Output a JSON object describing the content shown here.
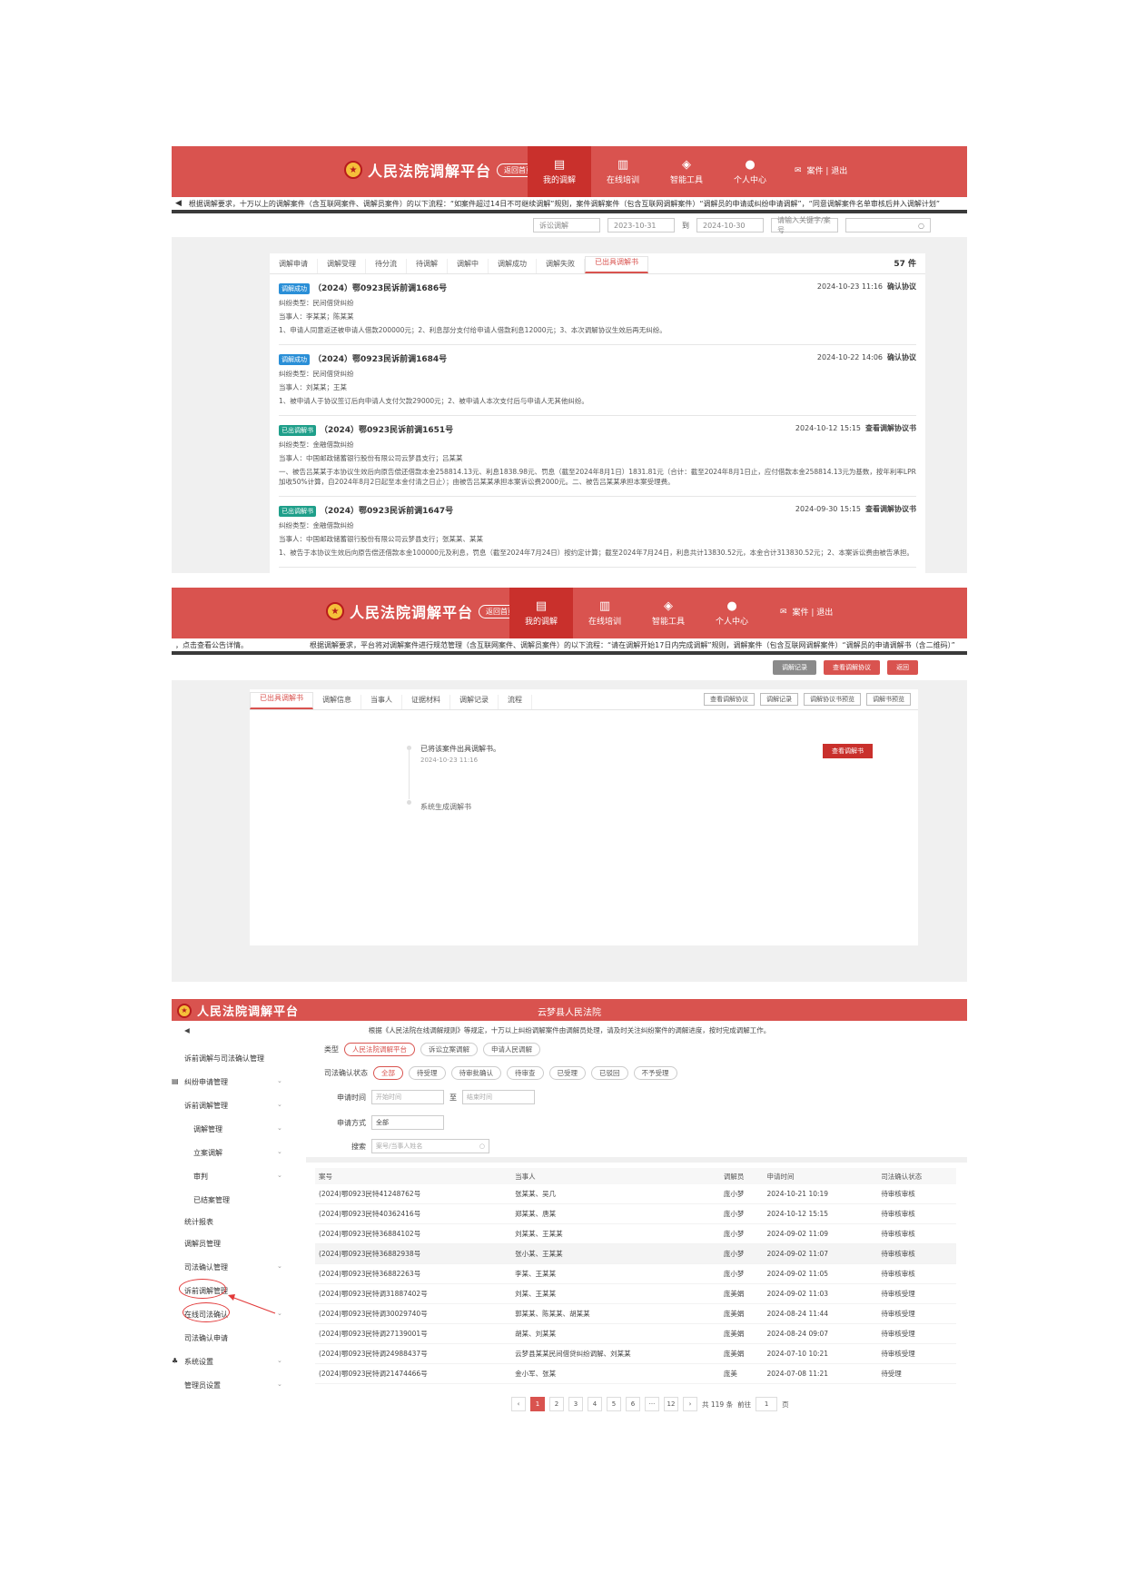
{
  "platform": {
    "name": "人民法院调解平台"
  },
  "shot1": {
    "pill": "返回首页",
    "nav": [
      {
        "icon": "▤",
        "label": "我的调解"
      },
      {
        "icon": "▥",
        "label": "在线培训"
      },
      {
        "icon": "◈",
        "label": "智能工具"
      },
      {
        "icon": "●",
        "label": "个人中心"
      }
    ],
    "user_links": "案件 | 退出",
    "ticker": "根据调解要求，十万以上的调解案件（含互联网案件、调解员案件）的以下流程：“如案件超过14日不可继续调解”规则，案件调解案件（包含互联网调解案件）“调解员的申请或纠纷申请调解”，“同意调解案件名单审核后并入调解计划”",
    "filters": {
      "type": "诉讼调解",
      "date_from": "2023-10-31",
      "to": "到",
      "date_to": "2024-10-30",
      "select": "请输入关键字/案号",
      "search_icon": "○"
    },
    "tabs": [
      "调解申请",
      "调解受理",
      "待分流",
      "待调解",
      "调解中",
      "调解成功",
      "调解失败",
      "已出具调解书"
    ],
    "active_tab": 7,
    "count": "57 件",
    "cases": [
      {
        "badge": "调解成功",
        "case_no": "（2024）鄂0923民诉前调1686号",
        "time": "2024-10-23 11:16",
        "status": "确认协议",
        "dispute": "纠纷类型：民间借贷纠纷",
        "parties": "当事人：李某某；陈某某",
        "detail": "1、申请人同意返还被申请人借款200000元；2、利息部分支付给申请人借款利息12000元；3、本次调解协议生效后再无纠纷。"
      },
      {
        "badge": "调解成功",
        "case_no": "（2024）鄂0923民诉前调1684号",
        "time": "2024-10-22 14:06",
        "status": "确认协议",
        "dispute": "纠纷类型：民间借贷纠纷",
        "parties": "当事人：刘某某；王某",
        "detail": "1、被申请人于协议签订后向申请人支付欠款29000元；2、被申请人本次支付后与申请人无其他纠纷。"
      },
      {
        "badge": "已出调解书",
        "case_no": "（2024）鄂0923民诉前调1651号",
        "time": "2024-10-12 15:15",
        "status": "查看调解协议书",
        "dispute": "纠纷类型：金融借款纠纷",
        "parties": "当事人：中国邮政储蓄银行股份有限公司云梦县支行；吕某某",
        "detail": "一、被告吕某某于本协议生效后向原告偿还借款本金258814.13元、利息1838.98元、罚息（截至2024年8月1日）1831.81元（合计：截至2024年8月1日止，应付借款本金258814.13元为基数，按年利率LPR加收50%计算，自2024年8月2日起至本金付清之日止）；由被告吕某某承担本案诉讼费2000元。二、被告吕某某承担本案受理费。"
      },
      {
        "badge": "已出调解书",
        "case_no": "（2024）鄂0923民诉前调1647号",
        "time": "2024-09-30 15:15",
        "status": "查看调解协议书",
        "dispute": "纠纷类型：金融借款纠纷",
        "parties": "当事人：中国邮政储蓄银行股份有限公司云梦县支行；张某某、某某",
        "detail": "1、被告于本协议生效后向原告偿还借款本金100000元及利息，罚息（截至2024年7月24日）按约定计算；截至2024年7月24日，利息共计13830.52元，本金合计313830.52元；2、本案诉讼费由被告承担。"
      }
    ]
  },
  "shot2": {
    "pill": "返回首页",
    "nav": [
      {
        "icon": "▤",
        "label": "我的调解"
      },
      {
        "icon": "▥",
        "label": "在线培训"
      },
      {
        "icon": "◈",
        "label": "智能工具"
      },
      {
        "icon": "●",
        "label": "个人中心"
      }
    ],
    "user_links": "案件 | 退出",
    "ticker_left": "，点击查看公告详情。",
    "ticker": "根据调解要求，平台将对调解案件进行规范管理（含互联网案件、调解员案件）的以下流程：“请在调解开始17日内完成调解”规则，调解案件（包含互联网调解案件）“调解员的申请调解书（含二维码）”",
    "actions": [
      "调解记录",
      "查看调解协议",
      "返回"
    ],
    "tabs": [
      "已出具调解书",
      "调解信息",
      "当事人",
      "证据材料",
      "调解记录",
      "流程"
    ],
    "tools": [
      "查看调解协议",
      "调解记录",
      "调解协议书预览",
      "调解书预览"
    ],
    "timeline": [
      {
        "title": "已将该案件出具调解书。",
        "time": "2024-10-23 11:16"
      },
      {
        "title": "系统生成调解书",
        "time": ""
      }
    ],
    "red_button": "查看调解书"
  },
  "shot3": {
    "court": "云梦县人民法院",
    "ticker": "根据《人民法院在线调解规则》等规定，十万以上纠纷调解案件由调解员处理，请及时关注纠纷案件的调解进度，按时完成调解工作。",
    "sidebar": [
      {
        "label": "诉前调解与司法确认管理",
        "chev": false
      },
      {
        "label": "纠纷申请管理",
        "chev": true
      },
      {
        "label": "诉前调解管理",
        "chev": true
      },
      {
        "label": "调解管理",
        "chev": true
      },
      {
        "label": "立案调解",
        "chev": true
      },
      {
        "label": "审判",
        "chev": true
      },
      {
        "label": "已结案管理",
        "chev": false
      },
      {
        "label": "统计报表",
        "chev": false
      },
      {
        "label": "调解员管理",
        "chev": false
      },
      {
        "label": "司法确认管理",
        "chev": true
      },
      {
        "label": "诉前调解管理",
        "chev": false
      },
      {
        "label": "在线司法确认",
        "chev": true
      },
      {
        "label": "司法确认申请",
        "chev": false
      },
      {
        "label": "系统设置",
        "chev": true
      },
      {
        "label": "管理员设置",
        "chev": true
      }
    ],
    "filters": {
      "type_label": "类型",
      "types": [
        "人民法院调解平台",
        "诉讼立案调解",
        "申请人民调解"
      ],
      "status_label": "司法确认状态",
      "statuses": [
        "全部",
        "待受理",
        "待审批确认",
        "待审查",
        "已受理",
        "已驳回",
        "不予受理"
      ],
      "date_label": "申请时间",
      "date_from_ph": "开始时间",
      "date_to_ph": "结束时间",
      "date_sep": "至",
      "method_label": "申请方式",
      "method_value": "全部",
      "search_label": "搜索",
      "search_ph": "案号/当事人姓名"
    },
    "table": {
      "headers": [
        "案号",
        "当事人",
        "调解员",
        "申请时间",
        "司法确认状态"
      ],
      "rows": [
        [
          "(2024)鄂0923民特41248762号",
          "张某某、吴几",
          "庞小梦",
          "2024-10-21 10:19",
          "待审核审核"
        ],
        [
          "(2024)鄂0923民特40362416号",
          "郑某某、唐某",
          "庞小梦",
          "2024-10-12 15:15",
          "待审核审核"
        ],
        [
          "(2024)鄂0923民特36884102号",
          "刘某某、王某某",
          "庞小梦",
          "2024-09-02 11:09",
          "待审核审核"
        ],
        [
          "(2024)鄂0923民特36882938号",
          "张小某、王某某",
          "庞小梦",
          "2024-09-02 11:07",
          "待审核审核"
        ],
        [
          "(2024)鄂0923民特36882263号",
          "李某、王某某",
          "庞小梦",
          "2024-09-02 11:05",
          "待审核审核"
        ],
        [
          "(2024)鄂0923民特调31887402号",
          "刘某、王某某",
          "庞美娟",
          "2024-09-02 11:03",
          "待审核受理"
        ],
        [
          "(2024)鄂0923民特调30029740号",
          "郭某某、陈某某、胡某某",
          "庞美娟",
          "2024-08-24 11:44",
          "待审核受理"
        ],
        [
          "(2024)鄂0923民特调27139001号",
          "胡某、刘某某",
          "庞美娟",
          "2024-08-24 09:07",
          "待审核受理"
        ],
        [
          "(2024)鄂0923民特调24988437号",
          "云梦县某某民间借贷纠纷调解、刘某某",
          "庞美娟",
          "2024-07-10 10:21",
          "待审核受理"
        ],
        [
          "(2024)鄂0923民特调21474466号",
          "金小军、张某",
          "庞美",
          "2024-07-08 11:21",
          "待受理"
        ]
      ],
      "selected_row": 3
    },
    "pager": {
      "prev": "‹",
      "pages": [
        "1",
        "2",
        "3",
        "4",
        "5",
        "6",
        "···",
        "12"
      ],
      "current": 0,
      "next": "›",
      "total": "共 119 条",
      "goto_label": "前往",
      "goto_value": "1",
      "page_suffix": "页"
    }
  }
}
